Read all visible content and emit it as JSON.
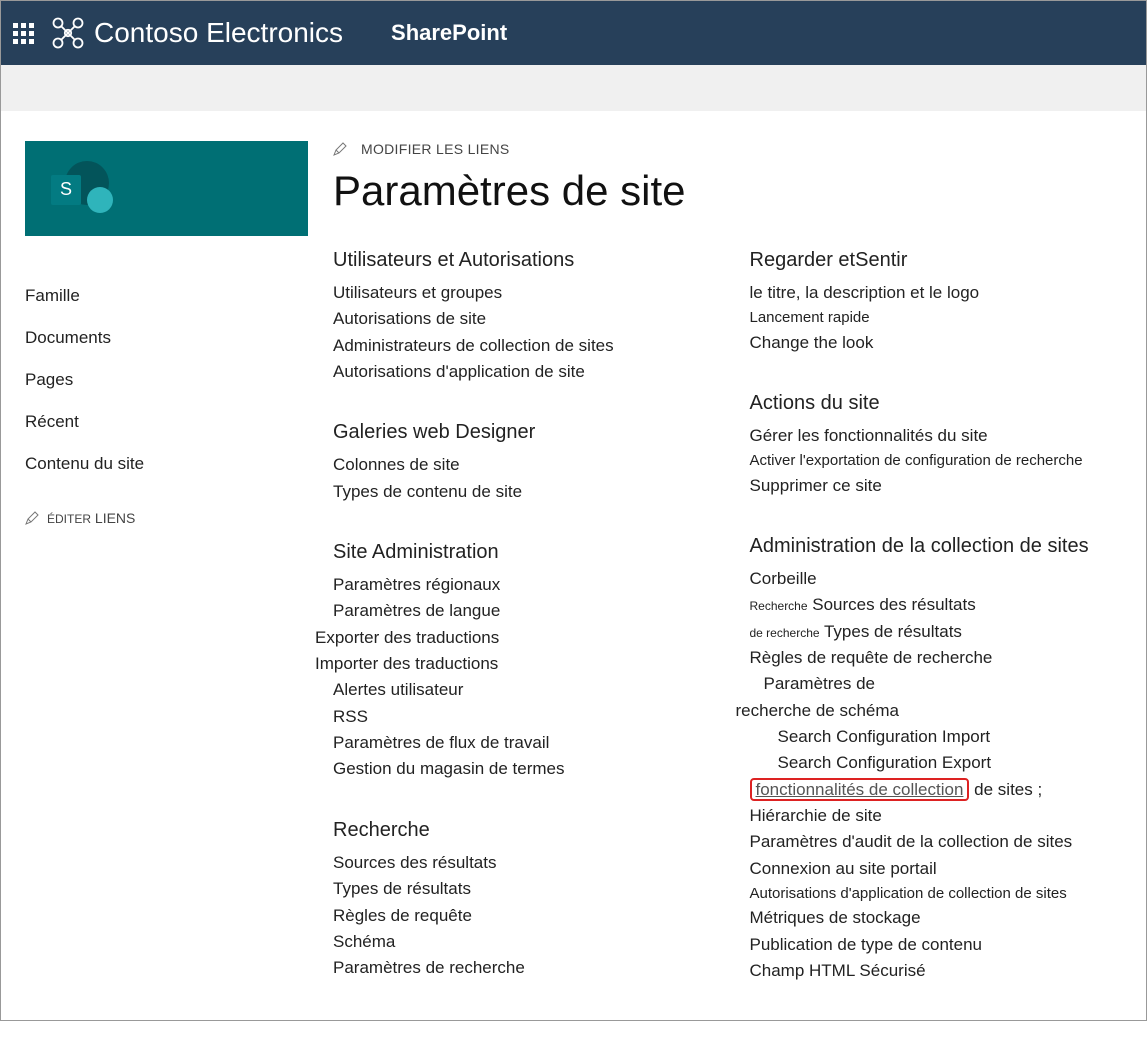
{
  "topbar": {
    "brand": "Contoso Electronics",
    "product": "SharePoint"
  },
  "editTopLabel": "MODIFIER LES LIENS",
  "pageTitle": "Paramètres de site",
  "leftnav": {
    "items": [
      "Famille",
      "Documents",
      "Pages",
      "Récent",
      "Contenu du site"
    ],
    "editPrefix": "ÉDITER",
    "editSuffix": "LIENS"
  },
  "logoTile": {
    "letter": "S"
  },
  "col1": {
    "usersPerm": {
      "heading": "Utilisateurs et  Autorisations",
      "links": [
        "Utilisateurs et groupes",
        "Autorisations de site",
        "Administrateurs de collection de sites",
        "Autorisations d'application de site"
      ]
    },
    "galleries": {
      "heading": "Galeries web Designer",
      "links": [
        "Colonnes de site",
        "Types de contenu de site"
      ]
    },
    "siteAdmin": {
      "heading": "Site Administration",
      "links": [
        "Paramètres régionaux",
        "Paramètres de langue",
        "Exporter des traductions",
        "Importer des traductions",
        "Alertes utilisateur",
        "RSS",
        "Paramètres de flux de travail",
        "Gestion du magasin de termes"
      ]
    },
    "recherche": {
      "heading": "Recherche",
      "links": [
        "Sources des résultats",
        "Types de résultats",
        "Règles de requête",
        "Schéma",
        "Paramètres de recherche"
      ]
    }
  },
  "col2": {
    "look": {
      "headingPrefix": "Regarder et",
      "headingSuffix": "Sentir",
      "links": [
        "le titre, la description et le logo",
        "Lancement rapide",
        "Change the look"
      ]
    },
    "siteActions": {
      "heading": "Actions du site",
      "links": [
        "Gérer les fonctionnalités du site",
        "Activer l'exportation de configuration de recherche",
        "Supprimer ce site"
      ]
    },
    "siteColl": {
      "heading": "Administration de la collection de sites",
      "corbeille": "Corbeille",
      "small1a": "Recherche",
      "small1b": "Sources des résultats",
      "small2a": "de recherche",
      "small2b": "Types de résultats",
      "regles": "Règles de requête de recherche",
      "param1": "Paramètres de",
      "param2": "recherche de schéma",
      "import": "Search Configuration Import",
      "export": "Search Configuration Export",
      "featuresBox": "fonctionnalités de collection",
      "featuresRest": "de sites ;",
      "hierarchy": "Hiérarchie de site",
      "audit": "Paramètres d'audit de la collection de sites",
      "portal": "Connexion au site portail",
      "appPerm": "Autorisations d'application de collection de sites",
      "storage": "Métriques de stockage",
      "ctpub": "Publication de type de contenu",
      "htmlA": "Champ HTML",
      "htmlB": "Sécurisé"
    }
  }
}
